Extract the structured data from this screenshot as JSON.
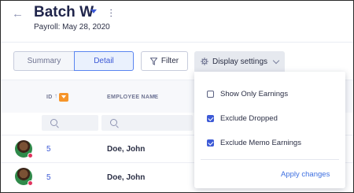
{
  "header": {
    "back_icon": "arrow-left-icon",
    "title": "Batch W",
    "subtitle": "Payroll: May 28, 2020",
    "more_icon": "kebab-menu-icon"
  },
  "toolbar": {
    "view_tabs": [
      {
        "label": "Summary",
        "selected": false
      },
      {
        "label": "Detail",
        "selected": true
      }
    ],
    "filter_label": "Filter",
    "filter_icon": "funnel-icon",
    "display_label": "Display settings",
    "display_icon": "gear-icon"
  },
  "table": {
    "columns": [
      {
        "label": "ID",
        "sort": "ascending"
      },
      {
        "label": "EMPLOYEE NAME"
      }
    ],
    "rows": [
      {
        "id": "5",
        "name": "Doe, John",
        "avatar": "employee-photo",
        "status_color": "#e0335e"
      },
      {
        "id": "5",
        "name": "Doe, John",
        "avatar": "employee-photo",
        "status_color": "#e0335e"
      }
    ]
  },
  "display_settings": {
    "options": [
      {
        "label": "Show Only Earnings",
        "checked": false
      },
      {
        "label": "Exclude Dropped",
        "checked": true
      },
      {
        "label": "Exclude Memo Earnings",
        "checked": true
      }
    ],
    "apply_label": "Apply changes"
  },
  "colors": {
    "accent": "#3d5ad6",
    "sort_badge": "#f6952a",
    "link": "#3d6fe0"
  }
}
